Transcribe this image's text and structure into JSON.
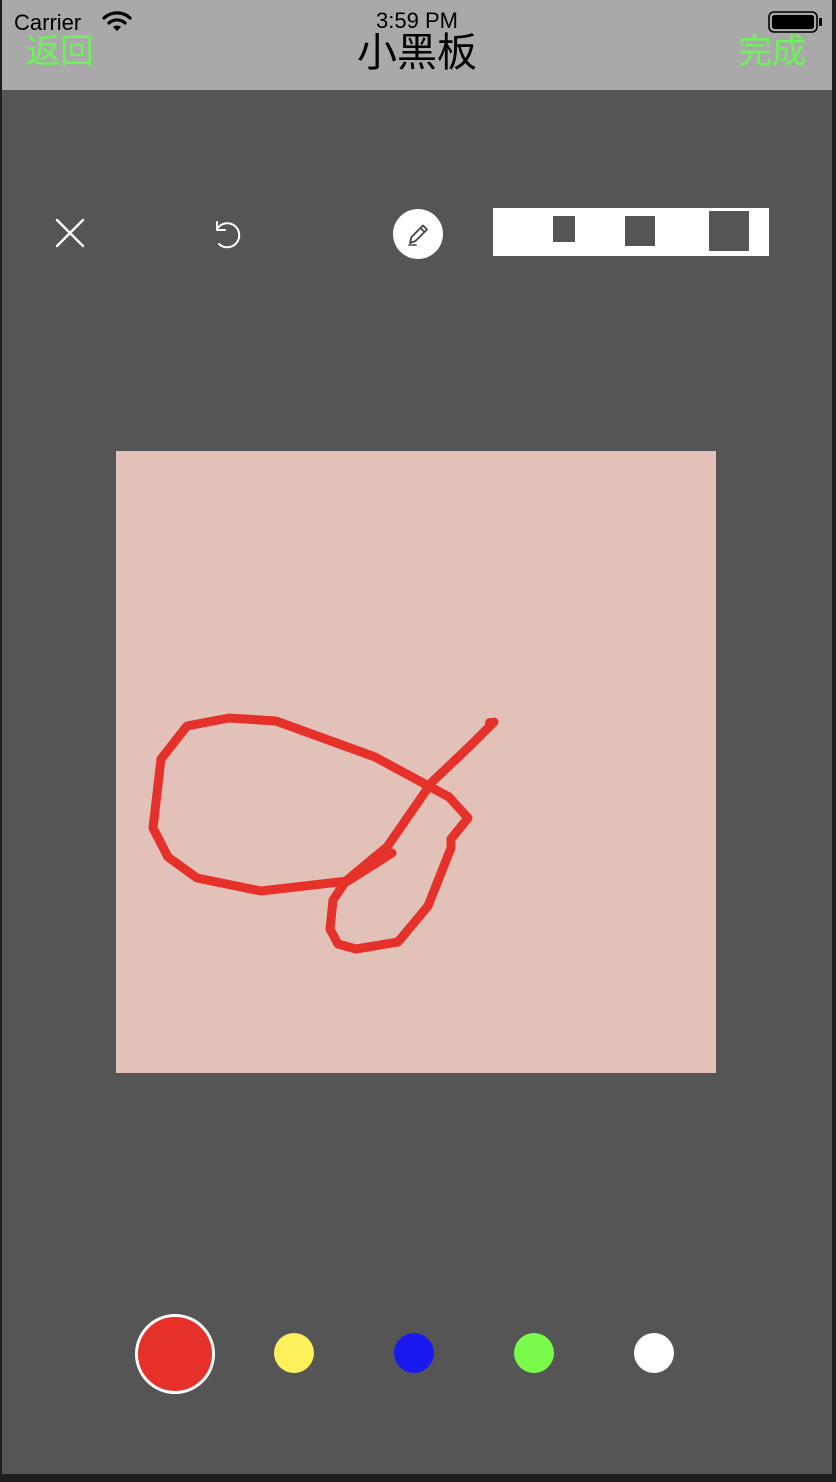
{
  "status_bar": {
    "carrier": "Carrier",
    "time": "3:59 PM"
  },
  "navbar": {
    "back_label": "返回",
    "title": "小黑板",
    "done_label": "完成"
  },
  "toolbar": {
    "tools": [
      "close-icon",
      "undo-icon",
      "pencil-icon"
    ],
    "active_tool": "pencil",
    "pen_sizes": [
      "small",
      "medium",
      "large"
    ]
  },
  "canvas": {
    "background_color": "#e1c1b8",
    "stroke_color": "#e5312a"
  },
  "palette": {
    "colors": [
      "#e5312a",
      "#fdf05a",
      "#1a1af0",
      "#7afa4a",
      "#ffffff"
    ],
    "selected": "#e5312a"
  },
  "colors": {
    "nav_bar": "#a9a9a9",
    "accent_green": "#6ef25a",
    "screen_bg": "#555555"
  }
}
